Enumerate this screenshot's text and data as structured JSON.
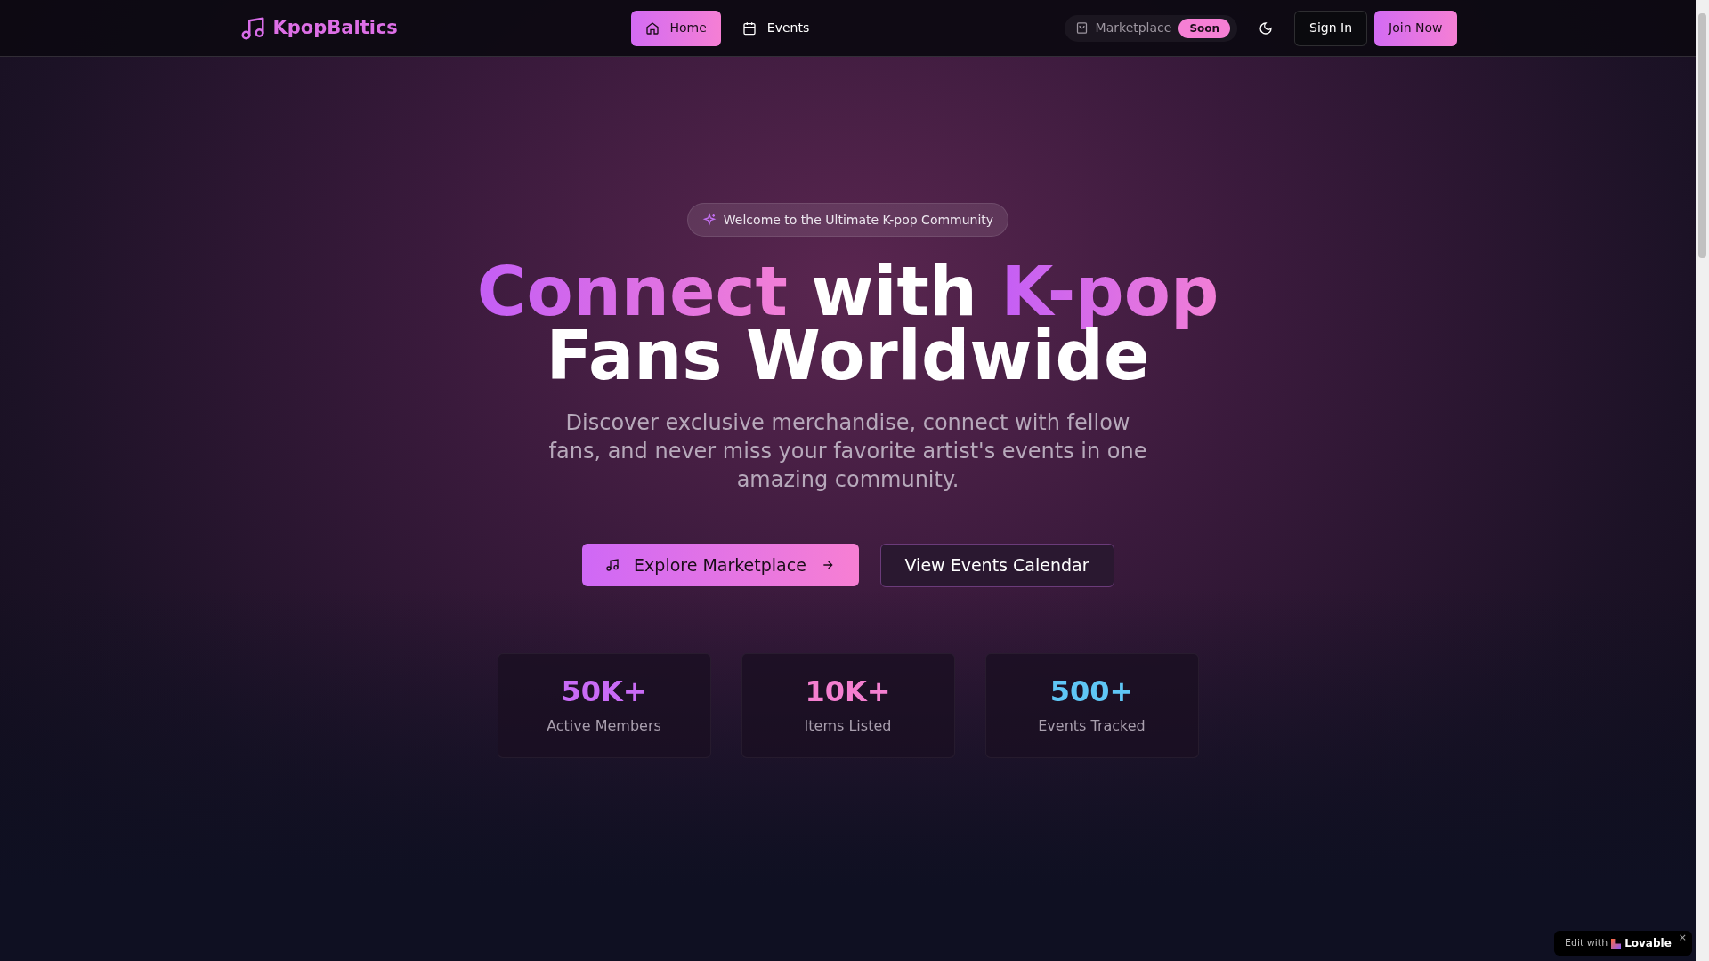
{
  "brand": {
    "name": "KpopBaltics"
  },
  "nav": [
    {
      "label": "Home",
      "selected": true
    },
    {
      "label": "Events",
      "selected": false
    }
  ],
  "marketplace": {
    "label": "Marketplace",
    "badge": "Soon",
    "disabled": true
  },
  "actions": [
    {
      "label": "Sign In",
      "kind": "outline"
    },
    {
      "label": "Join Now",
      "kind": "primary"
    }
  ],
  "hero": {
    "badge": "Welcome to the Ultimate K-pop Community",
    "heading_lines": [
      [
        {
          "text": "Connect",
          "highlight": true
        },
        {
          "text": " with ",
          "highlight": false
        },
        {
          "text": "K-pop",
          "highlight": true
        }
      ],
      [
        {
          "text": "Fans Worldwide",
          "highlight": false
        }
      ]
    ],
    "description": "Discover exclusive merchandise, connect with fellow fans, and never miss your favorite artist's events in one amazing community.",
    "buttons": [
      {
        "label": "Explore Marketplace",
        "kind": "primary"
      },
      {
        "label": "View Events Calendar",
        "kind": "outline"
      }
    ]
  },
  "stats": [
    {
      "value": "50K+",
      "label": "Active Members",
      "color": "#c96bf6"
    },
    {
      "value": "10K+",
      "label": "Items Listed",
      "color": "#f47fd0"
    },
    {
      "value": "500+",
      "label": "Events Tracked",
      "color": "#5fc6f5"
    }
  ],
  "edit_badge": {
    "prefix": "Edit with",
    "brand": "Lovable",
    "close": "×"
  }
}
